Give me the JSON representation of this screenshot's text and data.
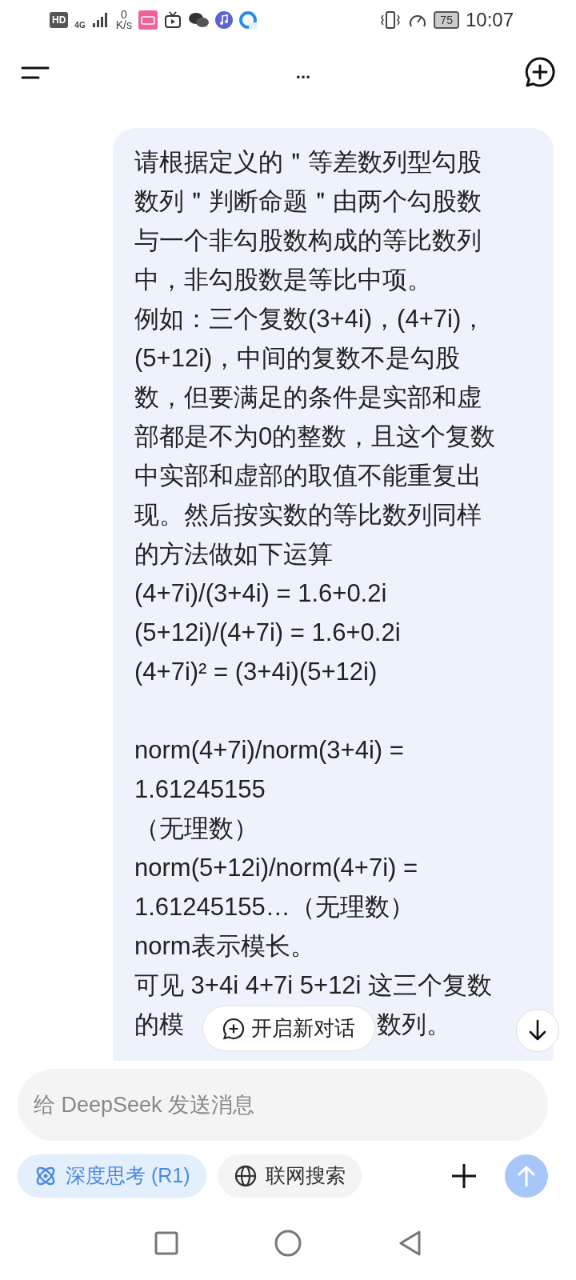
{
  "status_bar": {
    "hd": "HD",
    "network": "4G",
    "speed_value": "0",
    "speed_unit": "K/s",
    "battery": "75",
    "time": "10:07"
  },
  "header": {
    "title": "..."
  },
  "message": {
    "paragraphs": [
      {
        "lines": [
          "请根据定义的＂等差数列型勾股",
          "数列＂判断命题＂由两个勾股数",
          "与一个非勾股数构成的等比数列",
          "中，非勾股数是等比中项。",
          "例如：三个复数(3+4i)，(4+7i)，",
          "(5+12i)，中间的复数不是勾股",
          "数，但要满足的条件是实部和虚",
          "部都是不为0的整数，且这个复数",
          "中实部和虚部的取值不能重复出",
          "现。然后按实数的等比数列同样",
          "的方法做如下运算",
          "(4+7i)/(3+4i) = 1.6+0.2i",
          "(5+12i)/(4+7i) = 1.6+0.2i",
          "(4+7i)² = (3+4i)(5+12i)"
        ]
      },
      {
        "lines": [
          "norm(4+7i)/norm(3+4i) =",
          "1.61245155",
          "（无理数）",
          "norm(5+12i)/norm(4+7i) =",
          "1.61245155…（无理数）",
          "norm表示模长。",
          "可见 3+4i 4+7i 5+12i 这三个复数"
        ]
      }
    ],
    "last_line_parts": [
      "的模",
      "数列。"
    ]
  },
  "new_chat_button": {
    "label": "开启新对话"
  },
  "composer": {
    "placeholder": "给 DeepSeek 发送消息",
    "send_enabled": false
  },
  "toggles": [
    {
      "kind": "think",
      "label": "深度思考 (R1)",
      "selected": true
    },
    {
      "kind": "search",
      "label": "联网搜索",
      "selected": false
    }
  ]
}
